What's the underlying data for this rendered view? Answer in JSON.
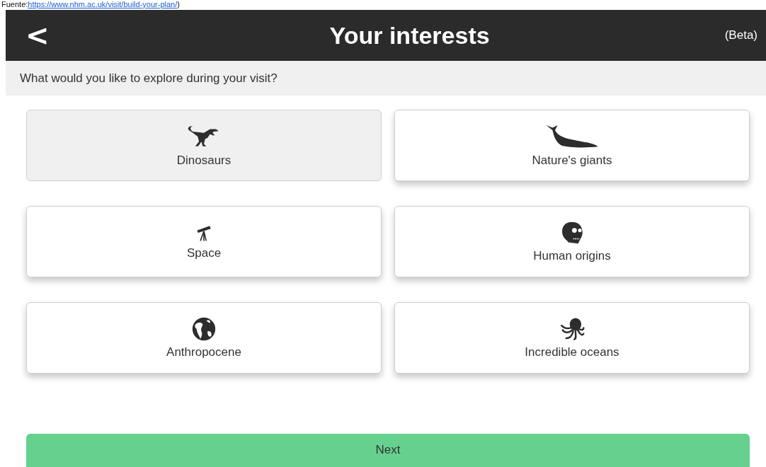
{
  "source_note": {
    "label": "Fuente:",
    "link": "https://www.nhm.ac.uk/visit/build-your-plan/",
    "tail": ")"
  },
  "header": {
    "back": "<",
    "title": "Your interests",
    "badge": "(Beta)"
  },
  "prompt": "What would you like to explore during your visit?",
  "interests": [
    {
      "label": "Dinosaurs",
      "selected": true
    },
    {
      "label": "Nature's giants",
      "selected": false
    },
    {
      "label": "Space",
      "selected": false
    },
    {
      "label": "Human origins",
      "selected": false
    },
    {
      "label": "Anthropocene",
      "selected": false
    },
    {
      "label": "Incredible oceans",
      "selected": false
    }
  ],
  "next_button": "Next"
}
